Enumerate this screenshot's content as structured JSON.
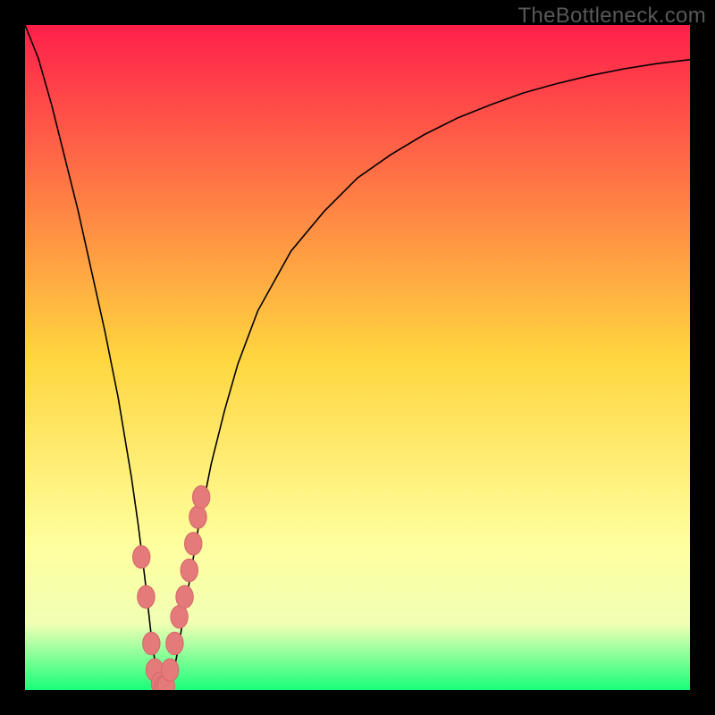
{
  "watermark": "TheBottleneck.com",
  "colors": {
    "frame": "#000000",
    "gradient_top": "#ff1f4b",
    "gradient_mid": "#ffd63f",
    "gradient_low": "#ffff9e",
    "gradient_band": "#f1ffb4",
    "gradient_bottom": "#19ff7a",
    "curve": "#000000",
    "marker_fill": "#e47a7a",
    "marker_stroke": "#d66a6a"
  },
  "chart_data": {
    "type": "line",
    "title": "",
    "xlabel": "",
    "ylabel": "",
    "xlim": [
      0,
      100
    ],
    "ylim": [
      0,
      100
    ],
    "x": [
      0,
      2,
      4,
      6,
      8,
      10,
      12,
      14,
      16,
      17,
      18,
      19,
      20,
      21,
      22,
      23,
      24,
      25,
      26,
      28,
      30,
      32,
      35,
      40,
      45,
      50,
      55,
      60,
      65,
      70,
      75,
      80,
      85,
      90,
      95,
      100
    ],
    "values": [
      100,
      95,
      88,
      80,
      72,
      63,
      54,
      44,
      32,
      25,
      17,
      8,
      1,
      0.5,
      1,
      6,
      12,
      18,
      24,
      34,
      42,
      49,
      57,
      66,
      72,
      77,
      80.5,
      83.5,
      86,
      88,
      89.8,
      91.2,
      92.4,
      93.4,
      94.2,
      94.8
    ],
    "markers": {
      "x": [
        17.5,
        18.2,
        19.0,
        19.5,
        20.3,
        20.8,
        21.2,
        21.8,
        22.5,
        23.2,
        24.0,
        24.7,
        25.3,
        26.0,
        26.5
      ],
      "y": [
        20,
        14,
        7,
        3,
        1,
        0.5,
        0.6,
        3,
        7,
        11,
        14,
        18,
        22,
        26,
        29
      ]
    },
    "notes": "V-shaped bottleneck curve with minimum near x≈21. Salmon markers cluster around the valley. No axis ticks or labels visible."
  }
}
